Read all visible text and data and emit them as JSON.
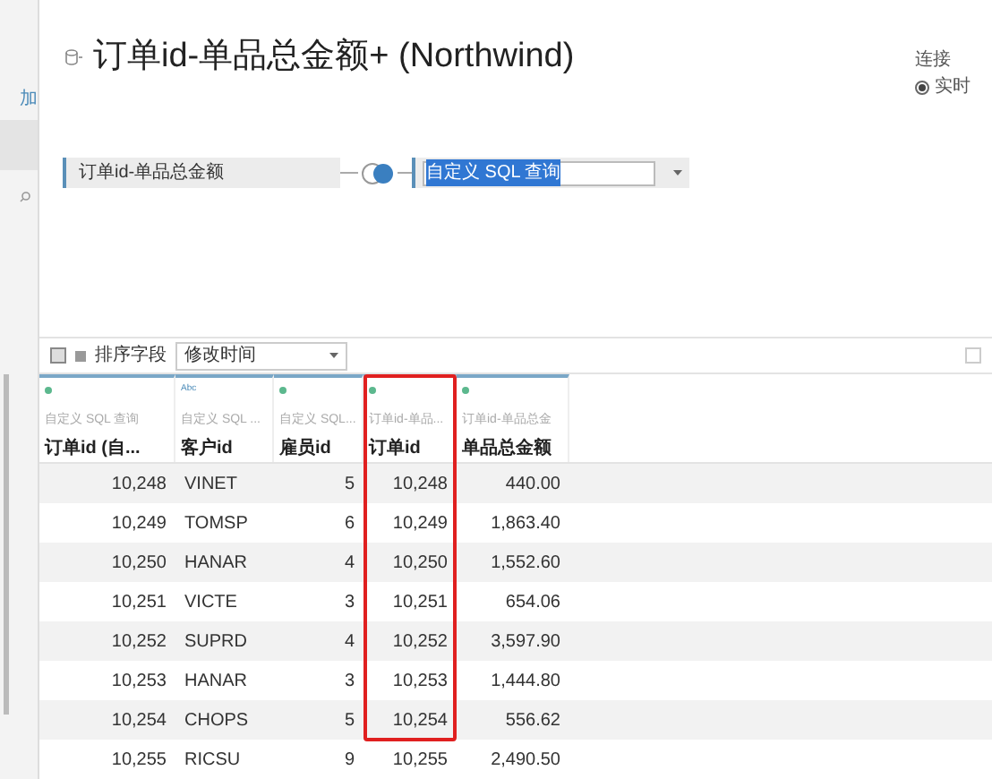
{
  "sidebar": {
    "add_link": "加"
  },
  "header": {
    "title": "订单id-单品总金额+ (Northwind)",
    "connection": {
      "label": "连接",
      "option": "实时",
      "selected": true
    }
  },
  "flow": {
    "table_name": "订单id-单品总金额",
    "query_select": "自定义 SQL 查询"
  },
  "toolbar": {
    "sort_label": "排序字段",
    "sort_value": "修改时间",
    "checked": false
  },
  "table": {
    "columns": [
      {
        "kind": "dot",
        "source": "自定义 SQL 查询",
        "name": "订单id (自...",
        "highlighted": false
      },
      {
        "kind": "text",
        "type_label": "Abc",
        "source": "自定义 SQL ...",
        "name": "客户id",
        "highlighted": false
      },
      {
        "kind": "dot",
        "source": "自定义 SQL...",
        "name": "雇员id",
        "highlighted": false
      },
      {
        "kind": "dot",
        "source": "订单id-单品...",
        "name": "订单id",
        "highlighted": true
      },
      {
        "kind": "dot",
        "source": "订单id-单品总金",
        "name": "单品总金额",
        "highlighted": false
      }
    ],
    "rows": [
      [
        "10,248",
        "VINET",
        "5",
        "10,248",
        "440.00"
      ],
      [
        "10,249",
        "TOMSP",
        "6",
        "10,249",
        "1,863.40"
      ],
      [
        "10,250",
        "HANAR",
        "4",
        "10,250",
        "1,552.60"
      ],
      [
        "10,251",
        "VICTE",
        "3",
        "10,251",
        "654.06"
      ],
      [
        "10,252",
        "SUPRD",
        "4",
        "10,252",
        "3,597.90"
      ],
      [
        "10,253",
        "HANAR",
        "3",
        "10,253",
        "1,444.80"
      ],
      [
        "10,254",
        "CHOPS",
        "5",
        "10,254",
        "556.62"
      ],
      [
        "10,255",
        "RICSU",
        "9",
        "10,255",
        "2,490.50"
      ]
    ]
  }
}
